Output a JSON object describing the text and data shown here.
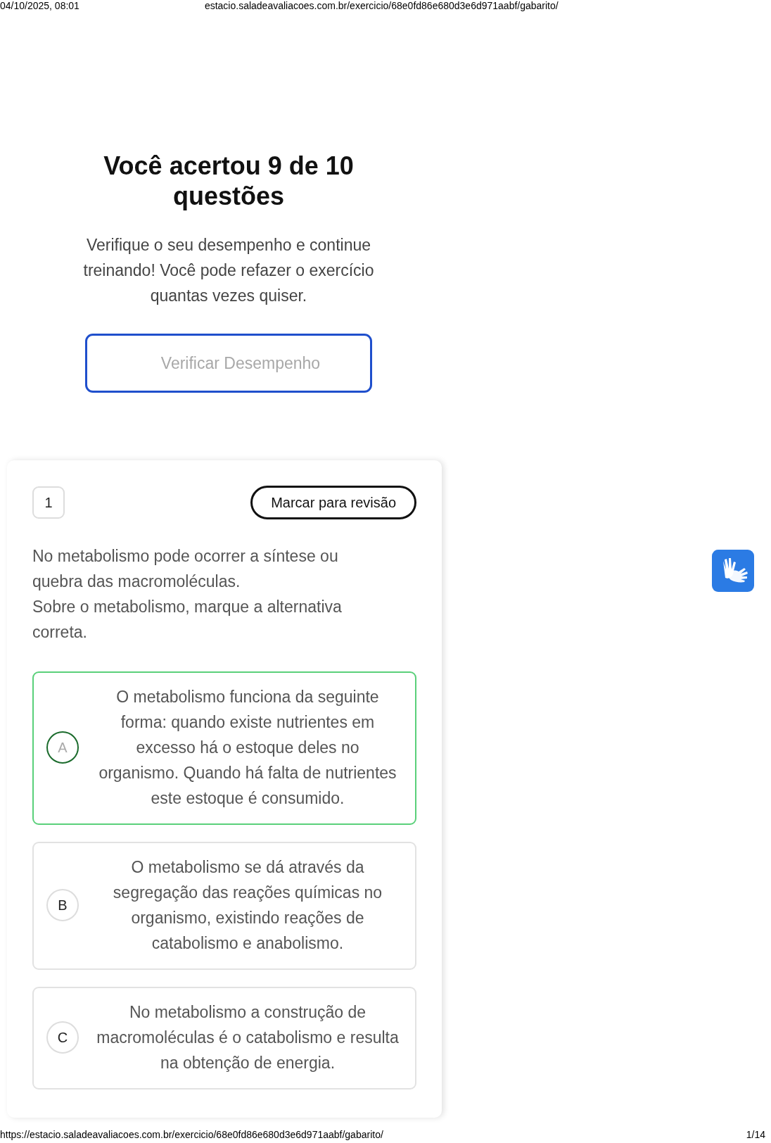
{
  "print_header": {
    "date": "04/10/2025, 08:01",
    "url": "estacio.saladeavaliacoes.com.br/exercicio/68e0fd86e680d3e6d971aabf/gabarito/"
  },
  "result": {
    "title": "Você acertou 9 de 10 questões",
    "subtitle": "Verifique o seu desempenho e continue treinando! Você pode refazer o exercício quantas vezes quiser.",
    "button": "Verificar Desempenho"
  },
  "question": {
    "number": "1",
    "review_button": "Marcar para revisão",
    "paragraphs": [
      "No metabolismo pode ocorrer a síntese ou quebra das macromoléculas.",
      "Sobre o metabolismo, marque a alternativa correta."
    ],
    "options": [
      {
        "letter": "A",
        "text": "O metabolismo funciona da seguinte forma: quando existe nutrientes em excesso há o estoque deles no organismo. Quando há falta de nutrientes este estoque é consumido.",
        "selected": true
      },
      {
        "letter": "B",
        "text": "O metabolismo se dá através da segregação das reações químicas no organismo, existindo reações de catabolismo e anabolismo.",
        "selected": false
      },
      {
        "letter": "C",
        "text": "No metabolismo a construção de macromoléculas é o catabolismo e resulta na obtenção de energia.",
        "selected": false
      }
    ]
  },
  "print_footer": {
    "url": "https://estacio.saladeavaliacoes.com.br/exercicio/68e0fd86e680d3e6d971aabf/gabarito/",
    "page": "1/14"
  }
}
